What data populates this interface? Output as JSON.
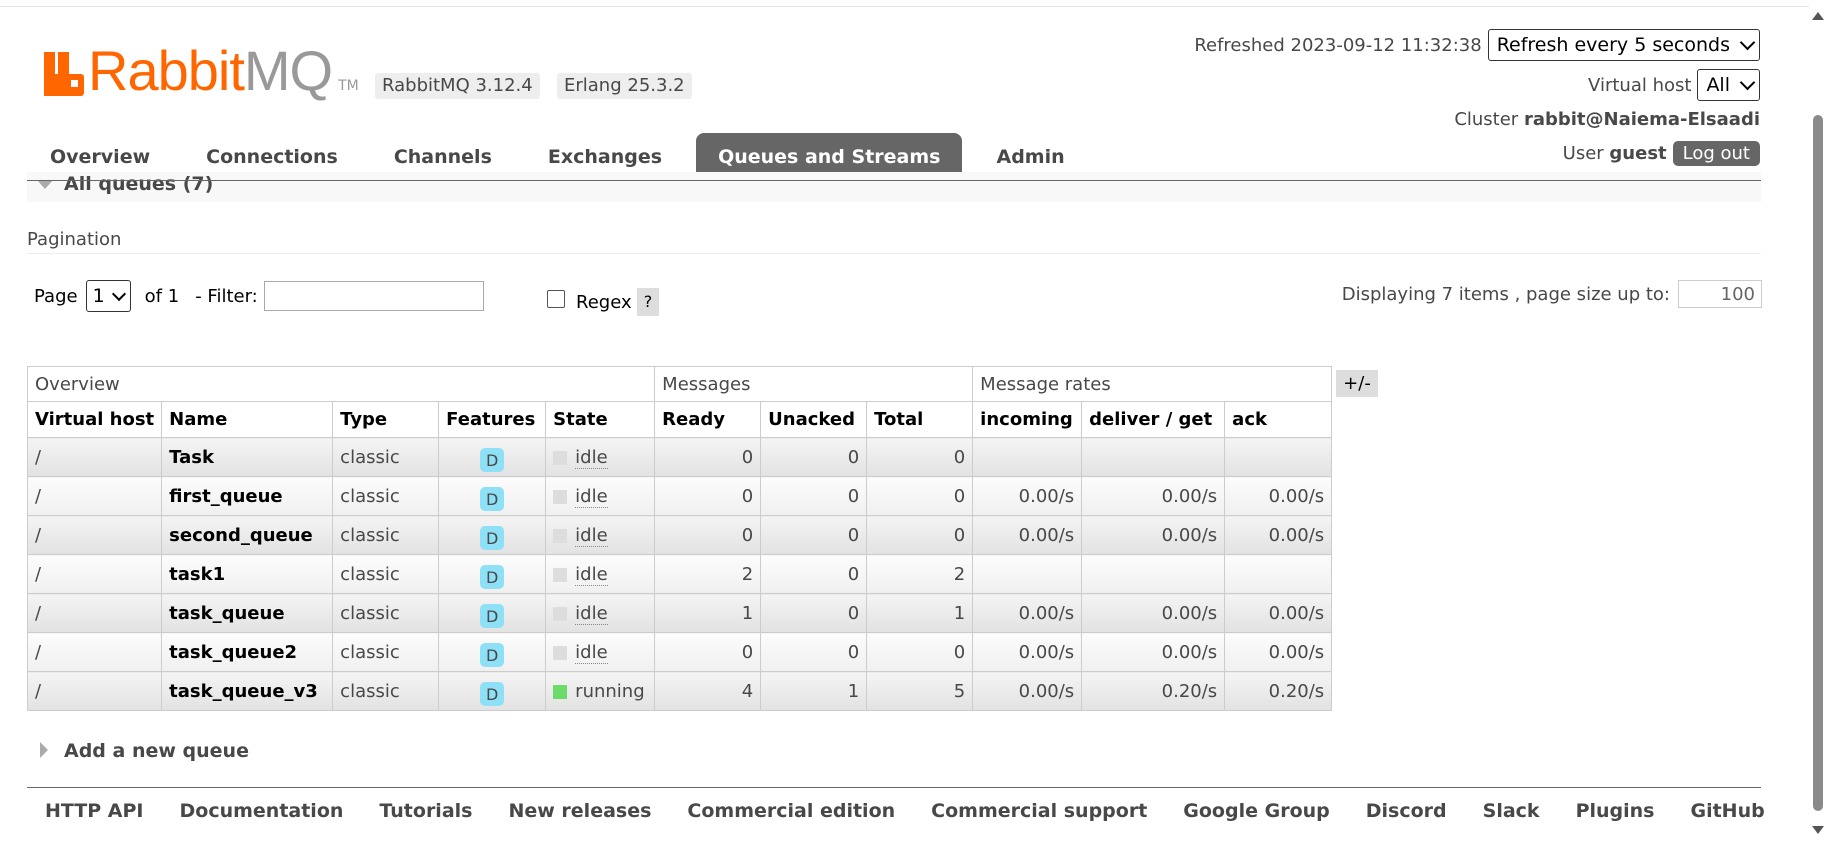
{
  "logo": {
    "rabbit": "Rabbit",
    "mq": "MQ",
    "tm": "TM"
  },
  "versions": {
    "rabbitmq": "RabbitMQ 3.12.4",
    "erlang": "Erlang 25.3.2"
  },
  "header": {
    "refreshed": "Refreshed 2023-09-12 11:32:38",
    "refresh_select": "Refresh every 5 seconds",
    "vhost_label": "Virtual host",
    "vhost_select": "All",
    "cluster_label": "Cluster",
    "cluster_name": "rabbit@Naiema-Elsaadi",
    "user_label": "User",
    "user_name": "guest",
    "logout": "Log out"
  },
  "tabs": [
    "Overview",
    "Connections",
    "Channels",
    "Exchanges",
    "Queues and Streams",
    "Admin"
  ],
  "active_tab": "Queues and Streams",
  "section": {
    "title": "All queues (7)"
  },
  "pagination": {
    "label": "Pagination",
    "page_label": "Page",
    "page_value": "1",
    "of": "of 1",
    "filter_label": "- Filter:",
    "regex": "Regex",
    "help": "?",
    "displaying": "Displaying 7 items , page size up to:",
    "page_size": "100"
  },
  "table": {
    "groups": {
      "overview": "Overview",
      "messages": "Messages",
      "rates": "Message rates"
    },
    "plusminus": "+/-",
    "columns": [
      "Virtual host",
      "Name",
      "Type",
      "Features",
      "State",
      "Ready",
      "Unacked",
      "Total",
      "incoming",
      "deliver / get",
      "ack"
    ],
    "rows": [
      {
        "vhost": "/",
        "name": "Task",
        "type": "classic",
        "feature": "D",
        "state": "idle",
        "ready": "0",
        "unacked": "0",
        "total": "0",
        "incoming": "",
        "deliver": "",
        "ack": ""
      },
      {
        "vhost": "/",
        "name": "first_queue",
        "type": "classic",
        "feature": "D",
        "state": "idle",
        "ready": "0",
        "unacked": "0",
        "total": "0",
        "incoming": "0.00/s",
        "deliver": "0.00/s",
        "ack": "0.00/s"
      },
      {
        "vhost": "/",
        "name": "second_queue",
        "type": "classic",
        "feature": "D",
        "state": "idle",
        "ready": "0",
        "unacked": "0",
        "total": "0",
        "incoming": "0.00/s",
        "deliver": "0.00/s",
        "ack": "0.00/s"
      },
      {
        "vhost": "/",
        "name": "task1",
        "type": "classic",
        "feature": "D",
        "state": "idle",
        "ready": "2",
        "unacked": "0",
        "total": "2",
        "incoming": "",
        "deliver": "",
        "ack": ""
      },
      {
        "vhost": "/",
        "name": "task_queue",
        "type": "classic",
        "feature": "D",
        "state": "idle",
        "ready": "1",
        "unacked": "0",
        "total": "1",
        "incoming": "0.00/s",
        "deliver": "0.00/s",
        "ack": "0.00/s"
      },
      {
        "vhost": "/",
        "name": "task_queue2",
        "type": "classic",
        "feature": "D",
        "state": "idle",
        "ready": "0",
        "unacked": "0",
        "total": "0",
        "incoming": "0.00/s",
        "deliver": "0.00/s",
        "ack": "0.00/s"
      },
      {
        "vhost": "/",
        "name": "task_queue_v3",
        "type": "classic",
        "feature": "D",
        "state": "running",
        "ready": "4",
        "unacked": "1",
        "total": "5",
        "incoming": "0.00/s",
        "deliver": "0.20/s",
        "ack": "0.20/s"
      }
    ]
  },
  "add_queue": "Add a new queue",
  "footer": [
    "HTTP API",
    "Documentation",
    "Tutorials",
    "New releases",
    "Commercial edition",
    "Commercial support",
    "Google Group",
    "Discord",
    "Slack",
    "Plugins",
    "GitHub"
  ],
  "colors": {
    "brand": "#ff6600",
    "tab_active": "#666666",
    "running": "#6bdb6b",
    "feature_badge": "#8ee0f6"
  }
}
